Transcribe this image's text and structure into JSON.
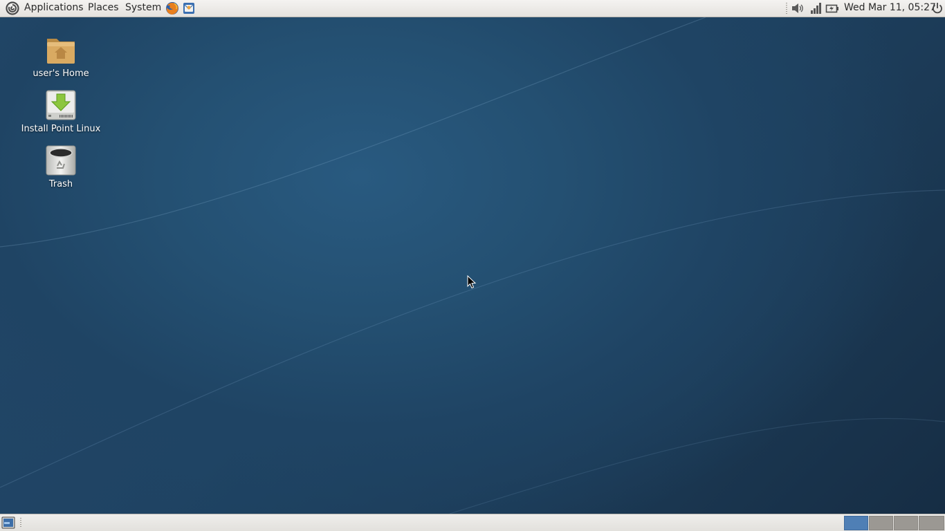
{
  "top_panel": {
    "distro_logo": "distro-swirl-icon",
    "menus": [
      "Applications",
      "Places",
      "System"
    ],
    "launchers": [
      "firefox-icon",
      "mail-client-icon"
    ],
    "tray": [
      "volume-icon",
      "network-signal-icon",
      "battery-icon",
      "power-icon"
    ],
    "clock": "Wed Mar 11, 05:27"
  },
  "desktop": {
    "icons": [
      {
        "label": "user's Home",
        "icon": "home-folder-icon"
      },
      {
        "label": "Install Point Linux",
        "icon": "install-disk-icon"
      },
      {
        "label": "Trash",
        "icon": "trash-icon"
      }
    ]
  },
  "bottom_panel": {
    "show_desktop": "show-desktop-icon",
    "workspaces": {
      "count": 4,
      "active": 1
    }
  },
  "colors": {
    "desktop_blue": "#245072",
    "panel_grey": "#e9e7e3",
    "active_workspace": "#4f7fb5",
    "inactive_workspace": "#9b9893"
  }
}
